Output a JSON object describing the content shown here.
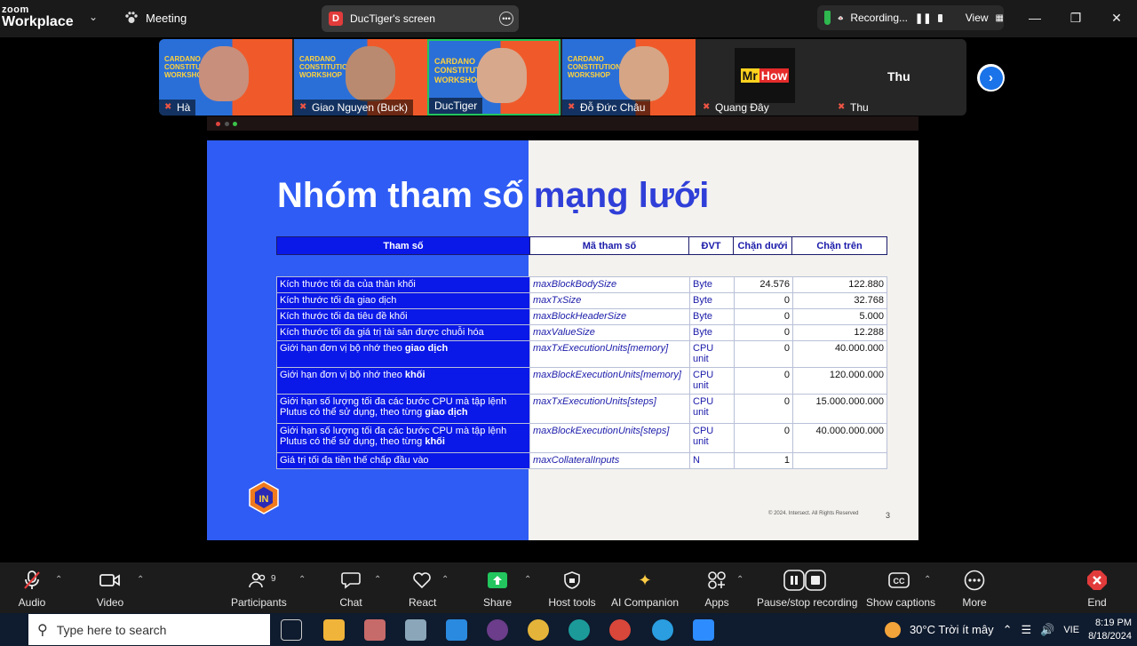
{
  "app": {
    "logo_small": "zoom",
    "logo_big": "Workplace",
    "meeting_label": "Meeting"
  },
  "share": {
    "badge": "D",
    "title": "DucTiger's screen"
  },
  "recording": {
    "status": "Recording...",
    "view_label": "View"
  },
  "participants": [
    {
      "name": "Hà",
      "title": "CARDANO CONSTITUTIONAL WORKSHOP"
    },
    {
      "name": "Giao Nguyen (Buck)",
      "title": "CARDANO CONSTITUTIONAL WORKSHOP"
    },
    {
      "name": "DucTiger",
      "title": "CARDANO CONSTITUTIONAL WORKSHOP"
    },
    {
      "name": "Đỗ Đức Châu",
      "title": "CARDANO CONSTITUTIONAL WORKSHOP"
    },
    {
      "name": "Quang Đây",
      "avatar_text_1": "Mr",
      "avatar_text_2": "How"
    },
    {
      "name": "Thu",
      "display": "Thu"
    }
  ],
  "slide": {
    "title_part1": "Nhóm tham số",
    "title_part2": "mạng lưới",
    "headers": [
      "Tham số",
      "Mã tham số",
      "ĐVT",
      "Chặn dưới",
      "Chặn trên"
    ],
    "rows": [
      {
        "param": "Kích thước tối đa của thân khối",
        "param_bold": "",
        "code": "maxBlockBodySize",
        "unit": "Byte",
        "min": "24.576",
        "max": "122.880"
      },
      {
        "param": "Kích thước tối đa giao dịch",
        "param_bold": "",
        "code": "maxTxSize",
        "unit": "Byte",
        "min": "0",
        "max": "32.768"
      },
      {
        "param": "Kích thước tối đa tiêu đề khối",
        "param_bold": "",
        "code": "maxBlockHeaderSize",
        "unit": "Byte",
        "min": "0",
        "max": "5.000"
      },
      {
        "param": "Kích thước tối đa giá trị tài sản được chuỗi hóa",
        "param_bold": "",
        "code": "maxValueSize",
        "unit": "Byte",
        "min": "0",
        "max": "12.288"
      },
      {
        "param": "Giới hạn đơn vị bộ nhớ theo ",
        "param_bold": "giao dịch",
        "code": "maxTxExecutionUnits[memory]",
        "unit": "CPU unit",
        "min": "0",
        "max": "40.000.000"
      },
      {
        "param": "Giới hạn đơn vị bộ nhớ theo ",
        "param_bold": "khối",
        "code": "maxBlockExecutionUnits[memory]",
        "unit": "CPU unit",
        "min": "0",
        "max": "120.000.000"
      },
      {
        "param": "Giới hạn số lượng tối đa các bước CPU mà tập lệnh Plutus có thể sử dụng, theo từng ",
        "param_bold": "giao dịch",
        "code": "maxTxExecutionUnits[steps]",
        "unit": "CPU unit",
        "min": "0",
        "max": "15.000.000.000"
      },
      {
        "param": "Giới hạn số lượng tối đa các bước CPU mà tập lệnh Plutus có thể sử dụng, theo từng ",
        "param_bold": "khối",
        "code": "maxBlockExecutionUnits[steps]",
        "unit": "CPU unit",
        "min": "0",
        "max": "40.000.000.000"
      },
      {
        "param": "Giá trị tối đa tiền thế chấp đầu vào",
        "param_bold": "",
        "code": "maxCollateralInputs",
        "unit": "N",
        "min": "1",
        "max": ""
      }
    ],
    "copyright": "© 2024. Intersect. All Rights Reserved",
    "page": "3",
    "logo_text": "IN"
  },
  "toolbar": {
    "audio": "Audio",
    "video": "Video",
    "participants": "Participants",
    "participants_count": "9",
    "chat": "Chat",
    "react": "React",
    "share": "Share",
    "host_tools": "Host tools",
    "ai_companion": "AI Companion",
    "apps": "Apps",
    "pause_stop": "Pause/stop recording",
    "show_captions": "Show captions",
    "more": "More",
    "end": "End"
  },
  "taskbar": {
    "search_placeholder": "Type here to search",
    "weather": "30°C  Trời ít mây",
    "lang": "VIE",
    "time": "8:19 PM",
    "date": "8/18/2024"
  },
  "colors": {
    "slide_blue": "#2f5cf4",
    "table_blue": "#0a18e8",
    "zoom_green": "#22c55e",
    "end_red": "#e23b3b"
  }
}
